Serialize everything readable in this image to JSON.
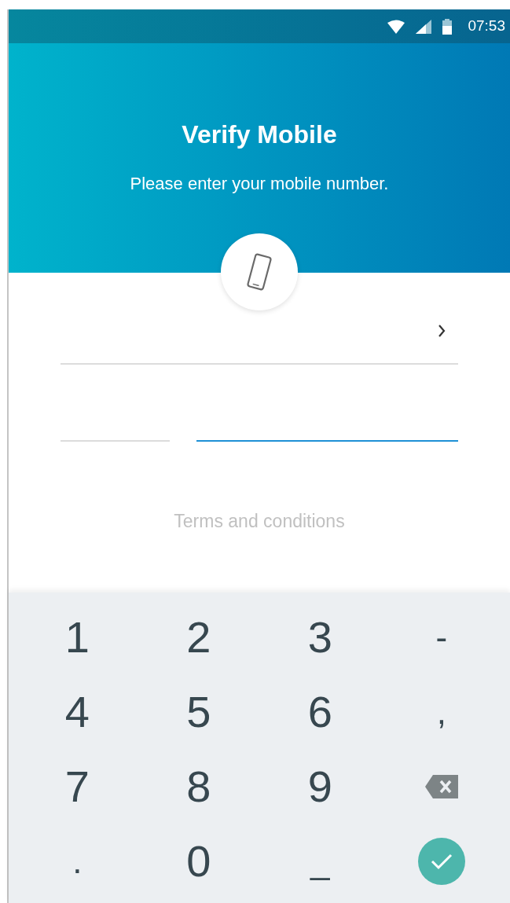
{
  "status_bar": {
    "time": "07:53"
  },
  "header": {
    "title": "Verify Mobile",
    "subtitle": "Please enter your mobile number."
  },
  "form": {
    "country_field": {
      "focused": false
    },
    "code_field": {
      "focused": false
    },
    "number_field": {
      "focused": true
    },
    "terms_link": "Terms and conditions"
  },
  "keypad": {
    "keys": [
      {
        "kind": "char",
        "label": "1"
      },
      {
        "kind": "char",
        "label": "2"
      },
      {
        "kind": "char",
        "label": "3"
      },
      {
        "kind": "char",
        "label": "-"
      },
      {
        "kind": "char",
        "label": "4"
      },
      {
        "kind": "char",
        "label": "5"
      },
      {
        "kind": "char",
        "label": "6"
      },
      {
        "kind": "char",
        "label": ","
      },
      {
        "kind": "char",
        "label": "7"
      },
      {
        "kind": "char",
        "label": "8"
      },
      {
        "kind": "char",
        "label": "9"
      },
      {
        "kind": "backspace"
      },
      {
        "kind": "char",
        "label": "."
      },
      {
        "kind": "char",
        "label": "0"
      },
      {
        "kind": "char",
        "label": "_"
      },
      {
        "kind": "done"
      }
    ]
  }
}
